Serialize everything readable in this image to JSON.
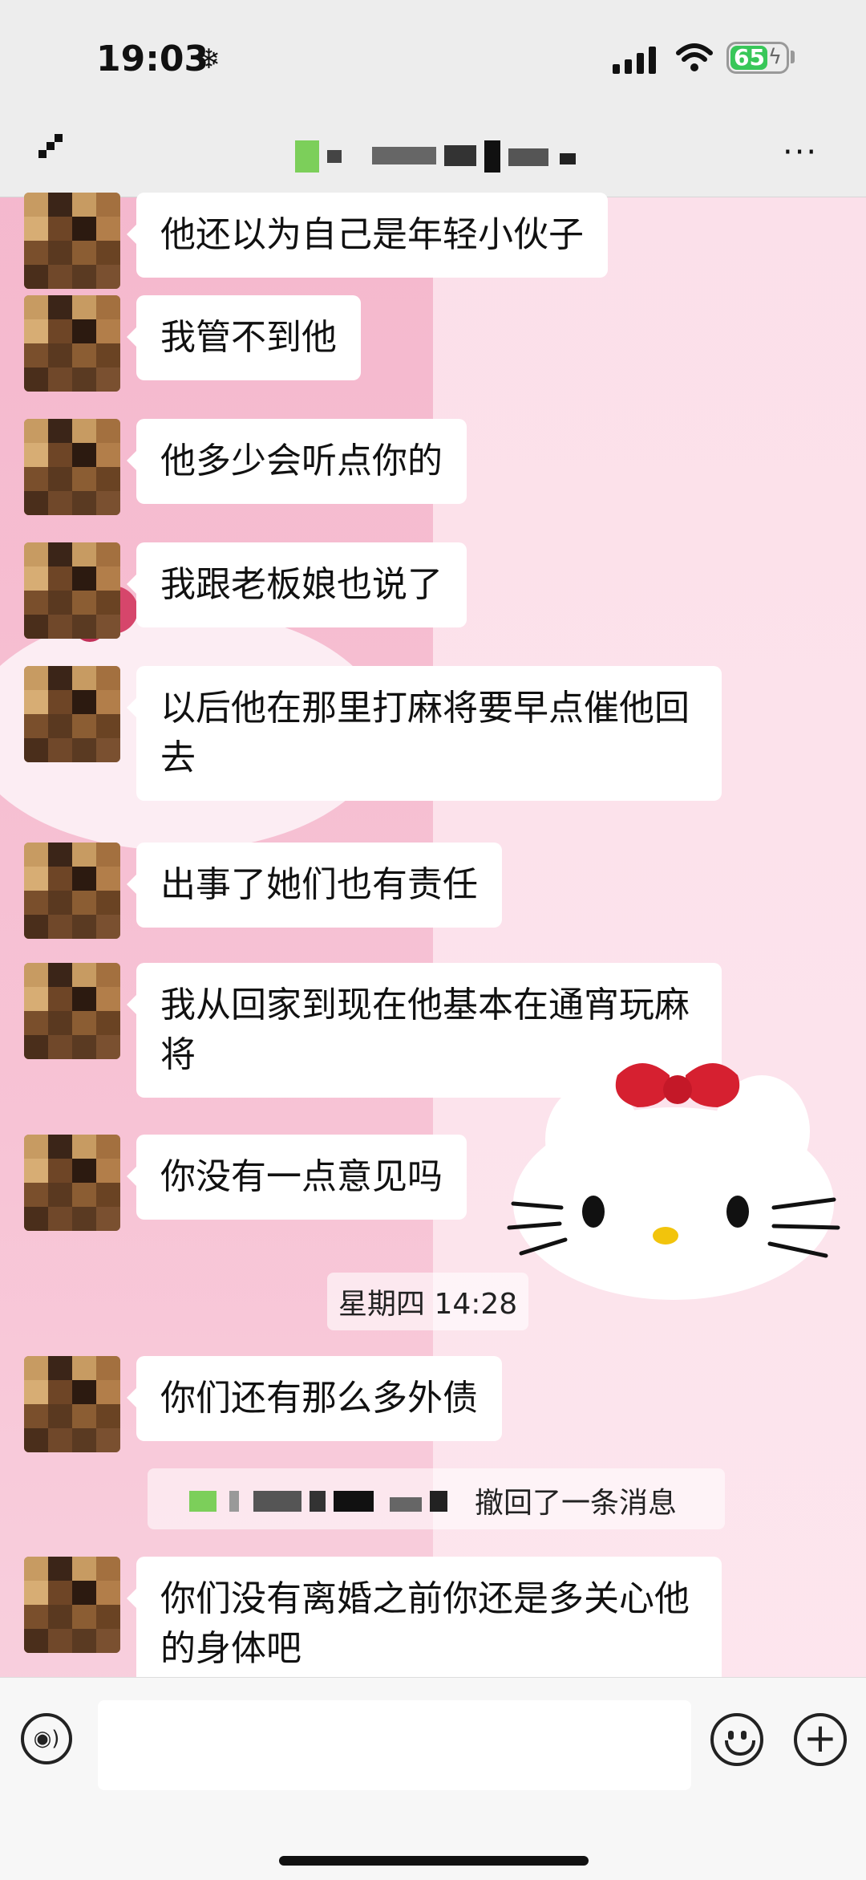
{
  "status_bar": {
    "time": "19:03",
    "battery": "65"
  },
  "nav": {
    "more_label": "···"
  },
  "messages": [
    {
      "text": "他还以为自己是年轻小伙子"
    },
    {
      "text": "我管不到他"
    },
    {
      "text": "他多少会听点你的"
    },
    {
      "text": "我跟老板娘也说了"
    },
    {
      "text": "以后他在那里打麻将要早点催他回去"
    },
    {
      "text": "出事了她们也有责任"
    },
    {
      "text": "我从回家到现在他基本在通宵玩麻将"
    },
    {
      "text": "你没有一点意见吗"
    },
    {
      "text": "你们还有那么多外债"
    },
    {
      "text": "你们没有离婚之前你还是多关心他的身体吧"
    }
  ],
  "timestamp": "星期四 14:28",
  "recall_notice": "撤回了一条消息",
  "input": {
    "placeholder": ""
  },
  "colors": {
    "bubble": "#ffffff",
    "bar": "#ededed",
    "wallpaper_left": "#f4b6cc",
    "wallpaper_right": "#fde6ee",
    "battery_green": "#38c759"
  },
  "icons": [
    "snowflake-icon",
    "signal-icon",
    "wifi-icon",
    "battery-icon",
    "back-icon",
    "more-icon",
    "voice-icon",
    "emoji-icon",
    "plus-icon"
  ]
}
